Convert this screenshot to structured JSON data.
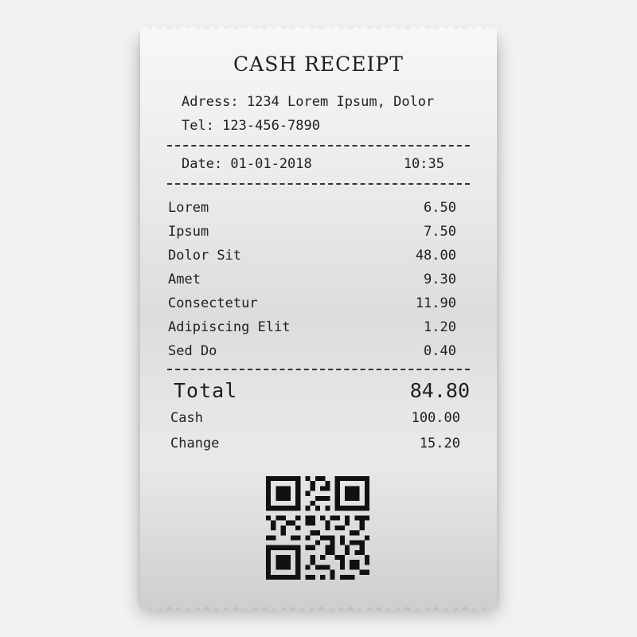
{
  "receipt": {
    "title": "CASH RECEIPT",
    "address": "Adress: 1234 Lorem Ipsum, Dolor",
    "tel": "Tel: 123-456-7890",
    "date": "Date: 01-01-2018",
    "time": "10:35",
    "items": [
      {
        "name": "Lorem",
        "price": "6.50"
      },
      {
        "name": "Ipsum",
        "price": "7.50"
      },
      {
        "name": "Dolor Sit",
        "price": "48.00"
      },
      {
        "name": "Amet",
        "price": "9.30"
      },
      {
        "name": "Consectetur",
        "price": "11.90"
      },
      {
        "name": "Adipiscing Elit",
        "price": "1.20"
      },
      {
        "name": "Sed Do",
        "price": "0.40"
      }
    ],
    "total_label": "Total",
    "total_value": "84.80",
    "cash_label": "Cash",
    "cash_value": "100.00",
    "change_label": "Change",
    "change_value": "15.20"
  },
  "colors": {
    "background": "#f2f2f2",
    "paper": "#e9e9e9",
    "ink": "#1f1f1f"
  },
  "icons": {
    "qr": "qr-code-icon"
  }
}
